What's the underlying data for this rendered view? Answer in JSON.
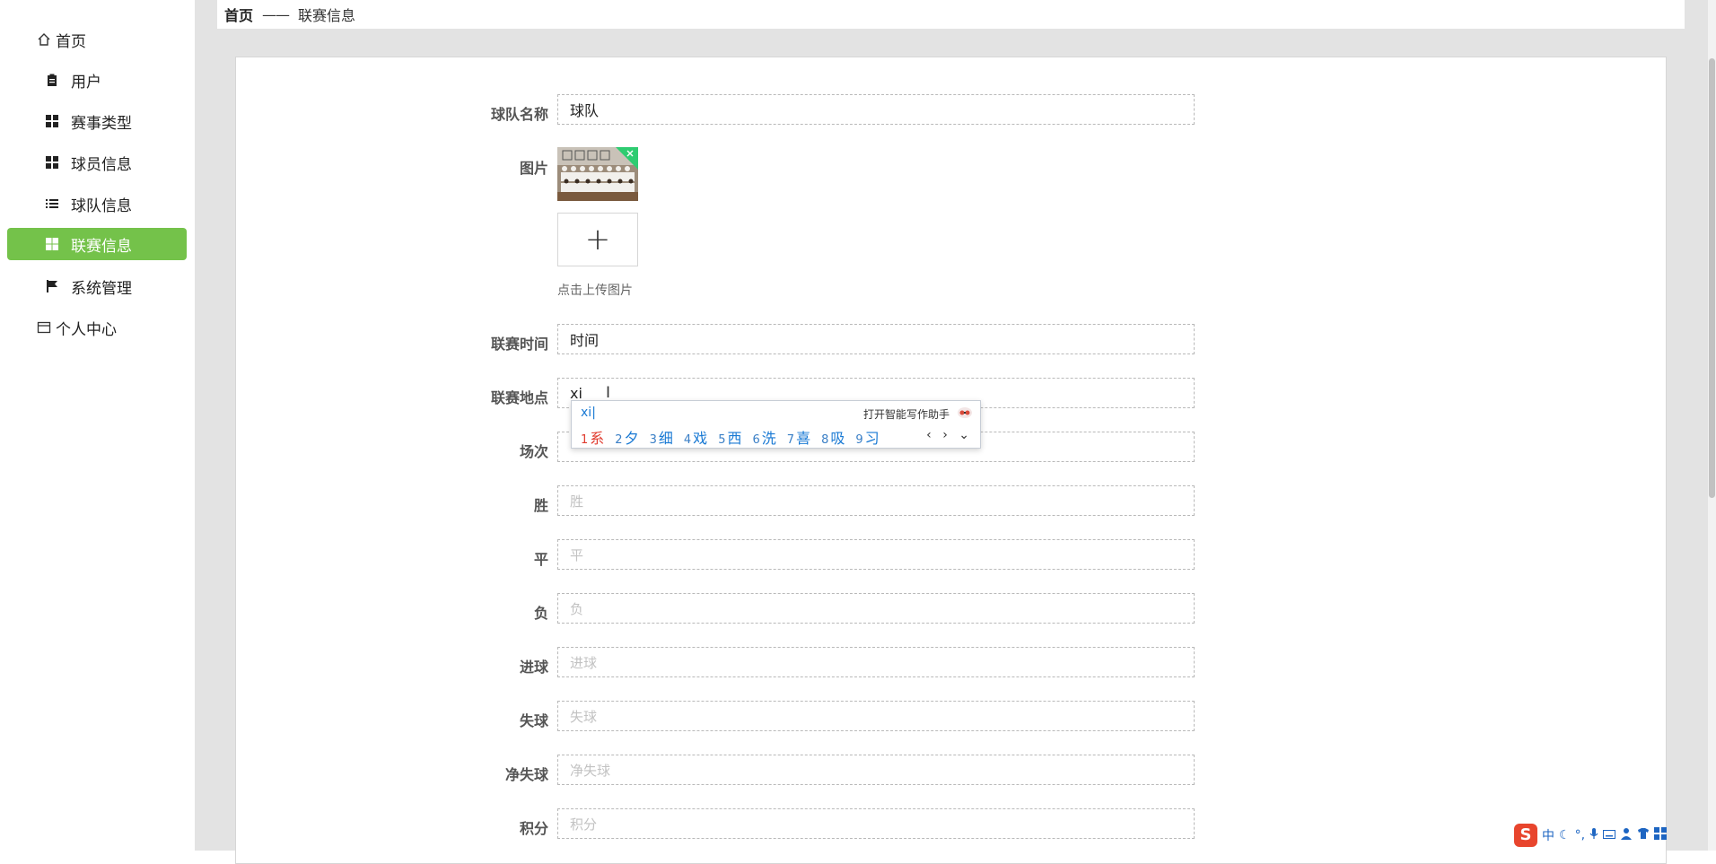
{
  "sidebar": {
    "items": [
      {
        "label": "首页",
        "icon": "home-icon"
      },
      {
        "label": "用户",
        "icon": "clipboard-icon"
      },
      {
        "label": "赛事类型",
        "icon": "grid-icon"
      },
      {
        "label": "球员信息",
        "icon": "grid-icon"
      },
      {
        "label": "球队信息",
        "icon": "list-icon"
      },
      {
        "label": "联赛信息",
        "icon": "grid-icon",
        "active": true
      },
      {
        "label": "系统管理",
        "icon": "flag-icon"
      },
      {
        "label": "个人中心",
        "icon": "wallet-icon"
      }
    ],
    "active_color": "#74c24a"
  },
  "breadcrumb": {
    "home": "首页",
    "separator": "——",
    "current": "联赛信息"
  },
  "form": {
    "team_name": {
      "label": "球队名称",
      "value": "球队"
    },
    "image": {
      "label": "图片",
      "upload_tip": "点击上传图片",
      "upload_symbol": "+"
    },
    "league_time": {
      "label": "联赛时间",
      "value": "时间"
    },
    "league_place": {
      "label": "联赛地点",
      "value": "xi"
    },
    "matches": {
      "label": "场次",
      "placeholder": ""
    },
    "wins": {
      "label": "胜",
      "placeholder": "胜"
    },
    "draws": {
      "label": "平",
      "placeholder": "平"
    },
    "losses": {
      "label": "负",
      "placeholder": "负"
    },
    "goals_for": {
      "label": "进球",
      "placeholder": "进球"
    },
    "goals_against": {
      "label": "失球",
      "placeholder": "失球"
    },
    "goal_diff": {
      "label": "净失球",
      "placeholder": "净失球"
    },
    "points": {
      "label": "积分",
      "placeholder": "积分"
    }
  },
  "ime": {
    "composition": "xi",
    "assistant": "打开智能写作助手",
    "candidates": [
      {
        "n": "1",
        "text": "系"
      },
      {
        "n": "2",
        "text": "夕"
      },
      {
        "n": "3",
        "text": "细"
      },
      {
        "n": "4",
        "text": "戏"
      },
      {
        "n": "5",
        "text": "西"
      },
      {
        "n": "6",
        "text": "洗"
      },
      {
        "n": "7",
        "text": "喜"
      },
      {
        "n": "8",
        "text": "吸"
      },
      {
        "n": "9",
        "text": "习"
      }
    ],
    "nav": "‹ › ⌄"
  },
  "tray": {
    "ime_logo": "S",
    "lang": "中"
  }
}
